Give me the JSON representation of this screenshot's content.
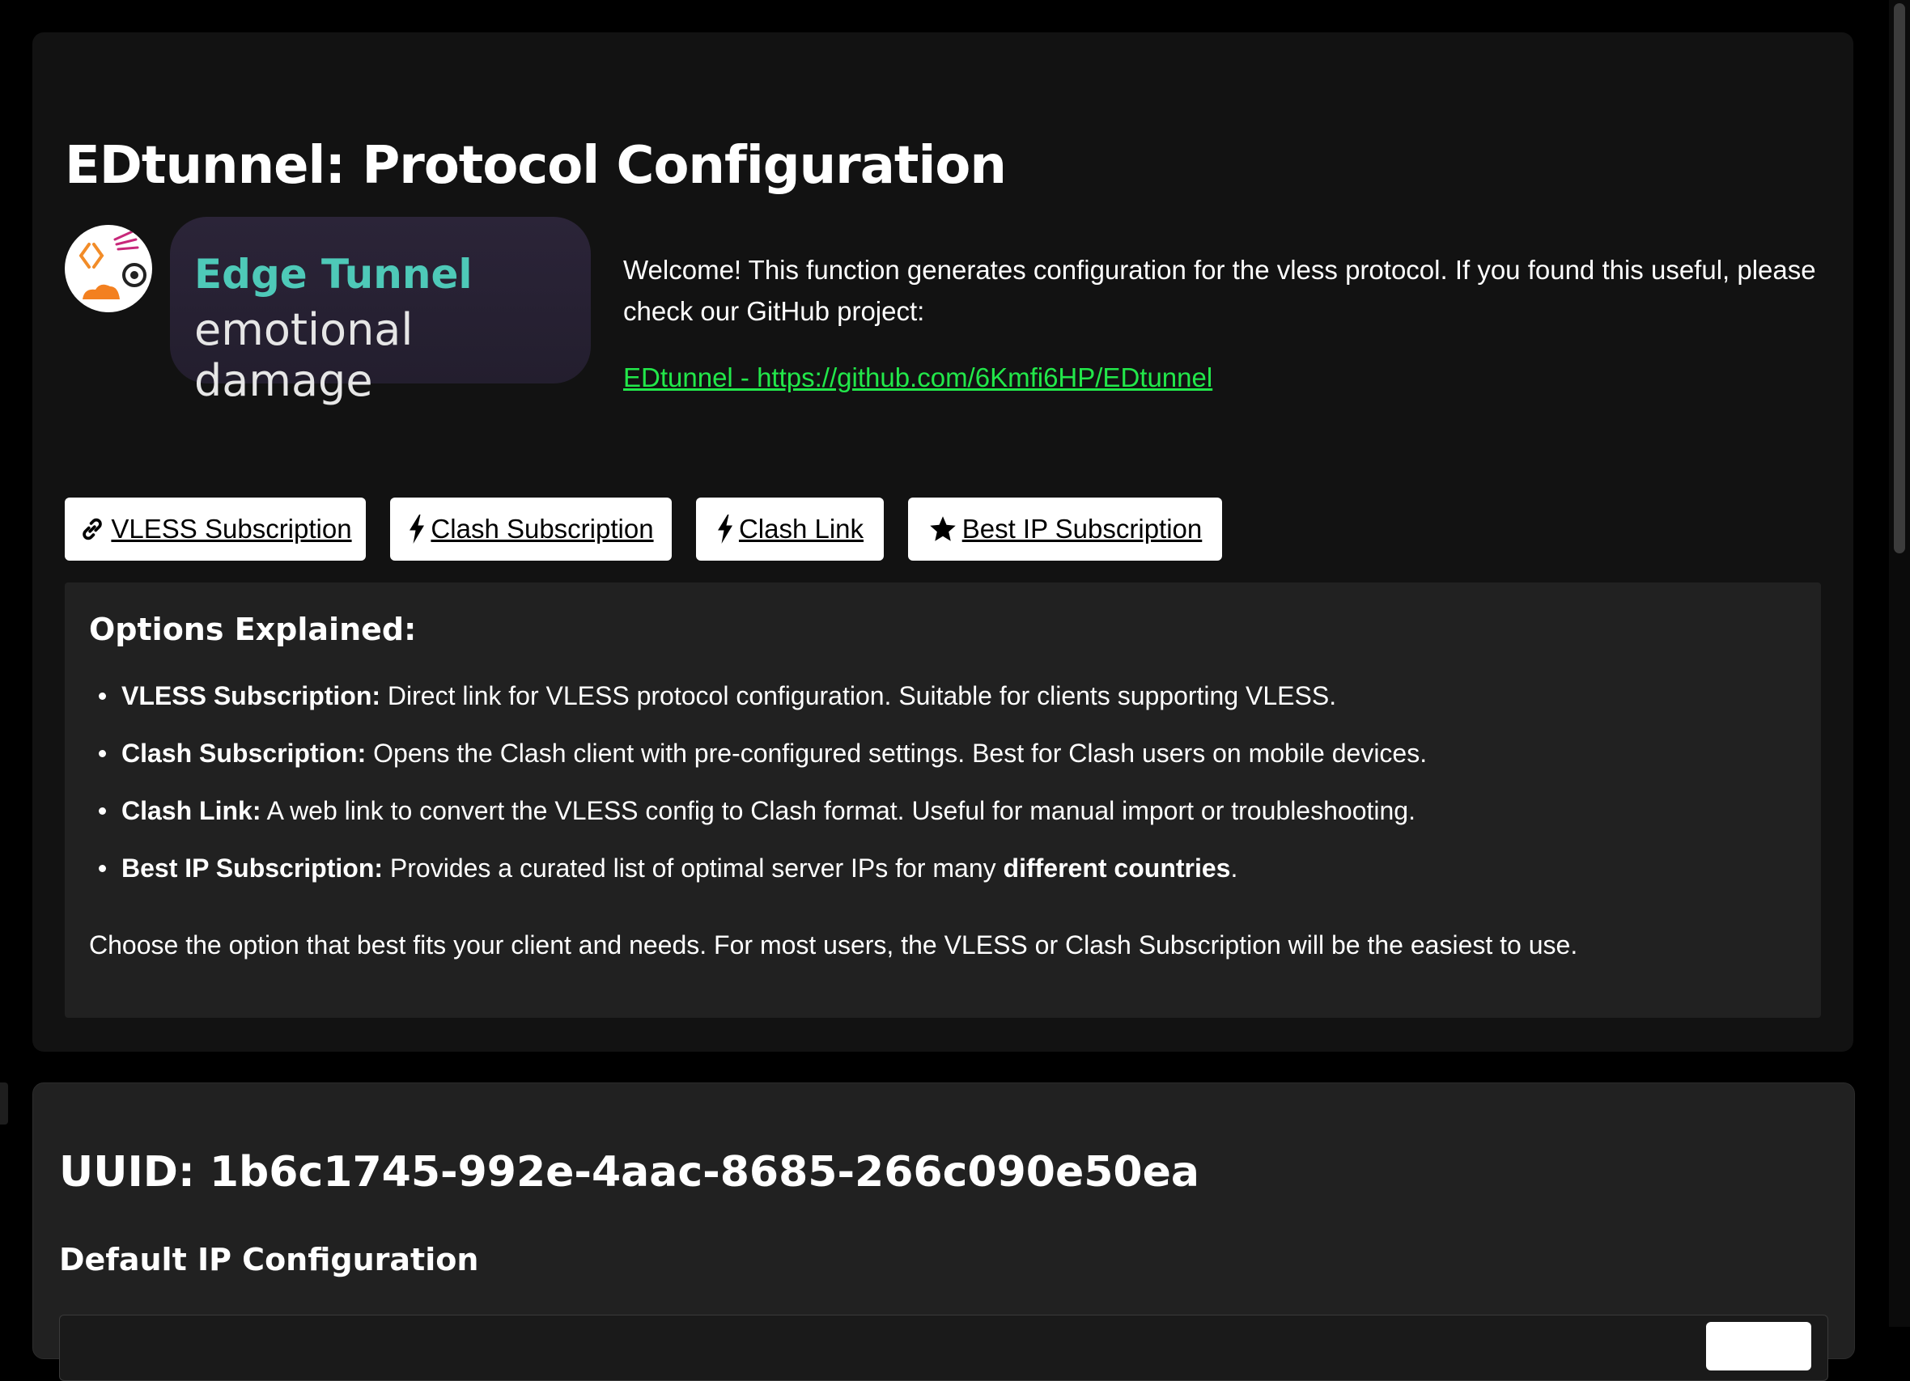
{
  "header": {
    "title": "EDtunnel: Protocol Configuration"
  },
  "logo": {
    "brand": "Edge Tunnel",
    "tagline": "emotional damage"
  },
  "intro": {
    "text": "Welcome! This function generates configuration for the vless protocol. If you found this useful, please check our GitHub project:",
    "link_text": "EDtunnel - https://github.com/6Kmfi6HP/EDtunnel"
  },
  "buttons": {
    "vless": {
      "label": "VLESS Subscription",
      "icon": "link-icon"
    },
    "clash_sub": {
      "label": "Clash Subscription",
      "icon": "bolt-icon"
    },
    "clash_link": {
      "label": "Clash Link",
      "icon": "bolt-icon"
    },
    "best_ip": {
      "label": "Best IP Subscription",
      "icon": "star-icon"
    }
  },
  "options": {
    "title": "Options Explained:",
    "items": [
      {
        "term": "VLESS Subscription:",
        "desc": " Direct link for VLESS protocol configuration. Suitable for clients supporting VLESS."
      },
      {
        "term": "Clash Subscription:",
        "desc": " Opens the Clash client with pre-configured settings. Best for Clash users on mobile devices."
      },
      {
        "term": "Clash Link:",
        "desc": " A web link to convert the VLESS config to Clash format. Useful for manual import or troubleshooting."
      },
      {
        "term": "Best IP Subscription:",
        "desc": " Provides a curated list of optimal server IPs for many ",
        "emph": "different countries",
        "tail": "."
      }
    ],
    "summary": "Choose the option that best fits your client and needs. For most users, the VLESS or Clash Subscription will be the easiest to use."
  },
  "config": {
    "uuid_label": "UUID: 1b6c1745-992e-4aac-8685-266c090e50ea",
    "default_ip_title": "Default IP Configuration"
  },
  "colors": {
    "link": "#22e84a",
    "brand_teal": "#4ec9b8",
    "card_bg": "#121212",
    "panel_bg": "#212121"
  }
}
